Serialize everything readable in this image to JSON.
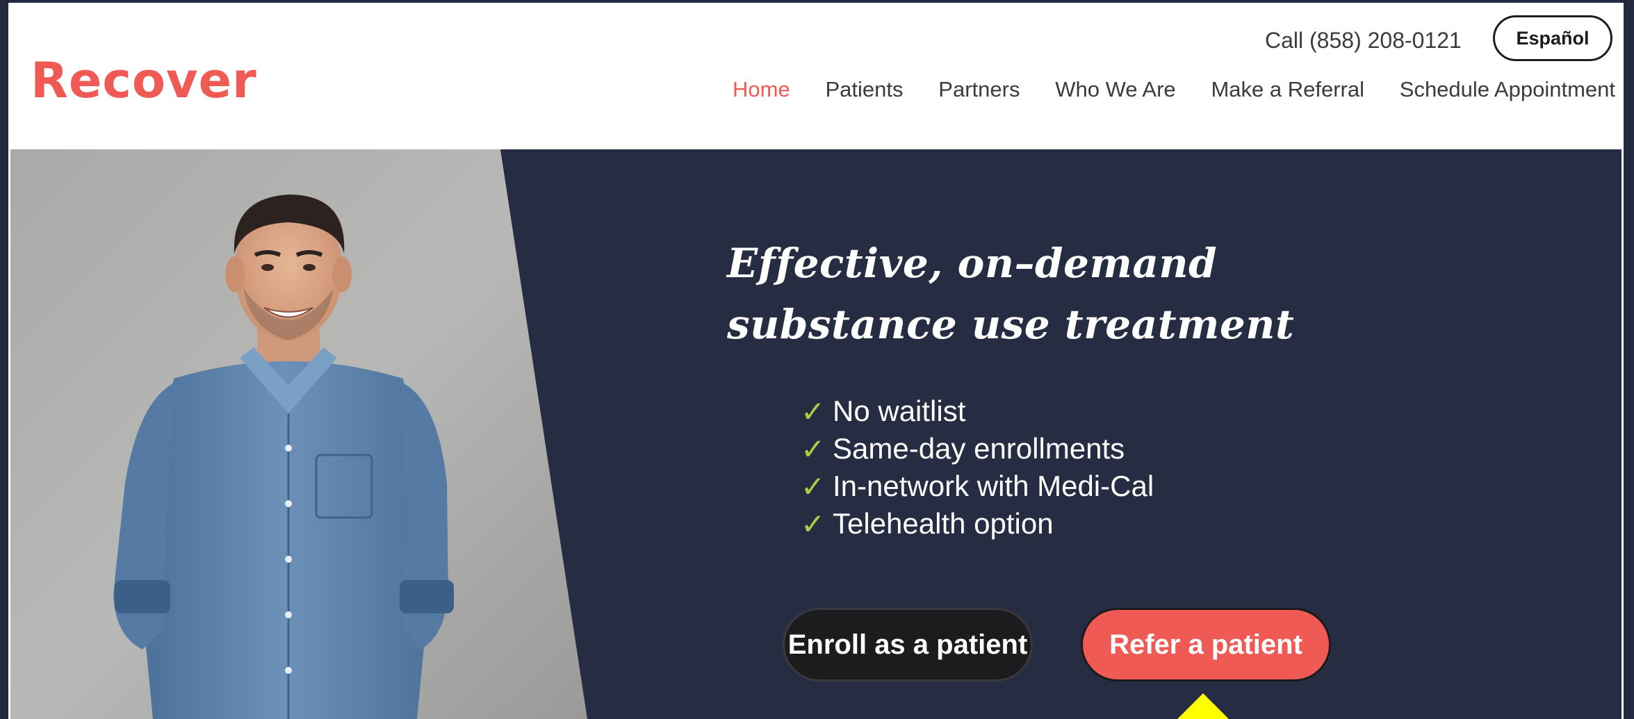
{
  "header": {
    "logo_text": "Recover",
    "call_text": "Call (858) 208-0121",
    "language_button": "Español",
    "nav": [
      {
        "label": "Home",
        "active": true
      },
      {
        "label": "Patients",
        "active": false
      },
      {
        "label": "Partners",
        "active": false
      },
      {
        "label": "Who We Are",
        "active": false
      },
      {
        "label": "Make a Referral",
        "active": false
      },
      {
        "label": "Schedule Appointment",
        "active": false
      }
    ]
  },
  "hero": {
    "headline_line1": "Effective, on–demand",
    "headline_line2": "substance use treatment",
    "features": [
      "No waitlist",
      "Same-day enrollments",
      "In-network with Medi-Cal",
      "Telehealth option"
    ],
    "check_glyph": "✓",
    "enroll_button": "Enroll as a patient",
    "refer_button": "Refer a patient"
  },
  "colors": {
    "brand": "#ef5a55",
    "navy": "#262c42",
    "check": "#a8cf45",
    "pointer": "#ffff00"
  }
}
